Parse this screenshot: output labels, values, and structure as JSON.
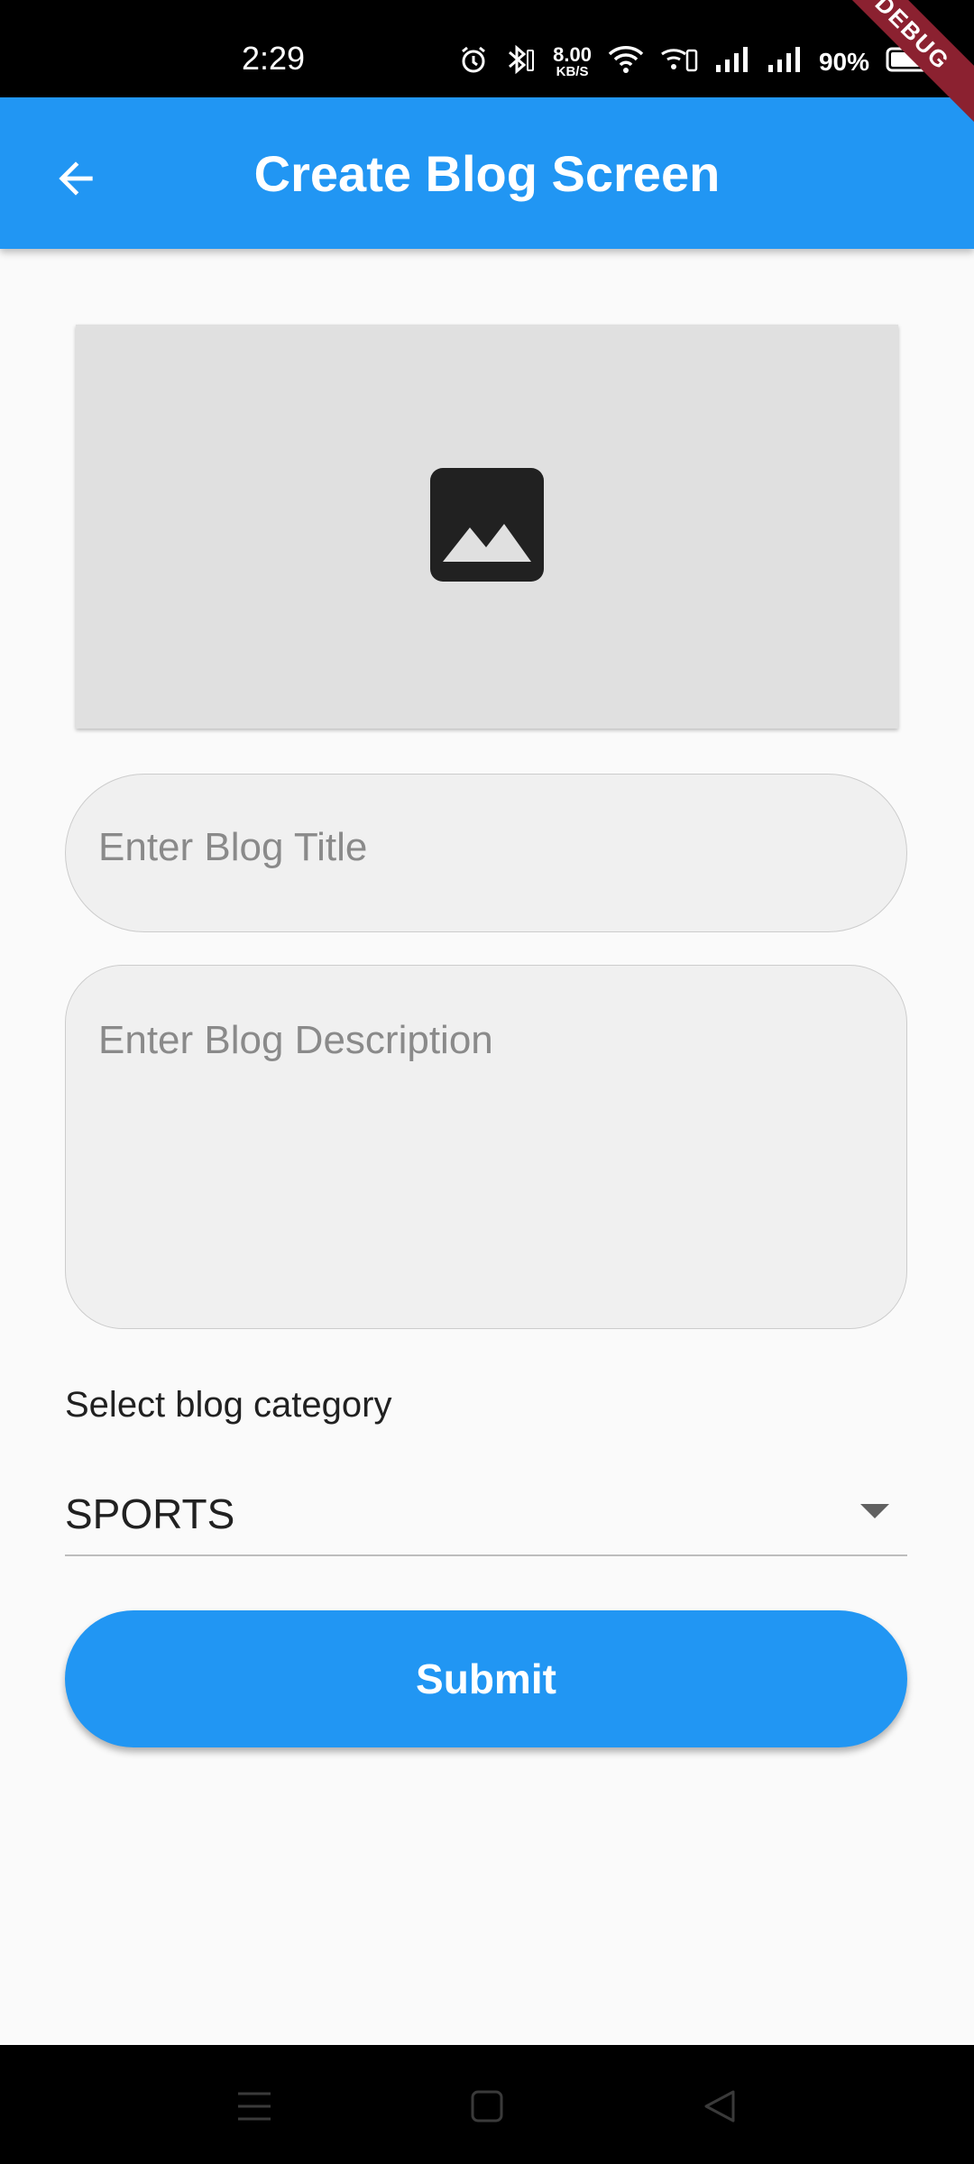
{
  "status_bar": {
    "time": "2:29",
    "net_speed_value": "8.00",
    "net_speed_unit": "KB/S",
    "battery_percent": "90%",
    "icons": [
      "alarm-icon",
      "bluetooth-icon",
      "wifi-icon",
      "wifi-calling-icon",
      "signal-icon",
      "signal-icon",
      "battery-icon"
    ]
  },
  "app_bar": {
    "title": "Create Blog Screen",
    "back_icon": "arrow-back-icon",
    "color": "#2196f3"
  },
  "debug_banner": "DEBUG",
  "image_picker": {
    "icon": "image-icon"
  },
  "form": {
    "title_placeholder": "Enter Blog Title",
    "description_placeholder": "Enter Blog Description",
    "category_label": "Select blog category",
    "category_value": "SPORTS",
    "submit_label": "Submit"
  },
  "nav_bar": {
    "icons": [
      "menu-icon",
      "home-icon",
      "back-icon"
    ]
  }
}
